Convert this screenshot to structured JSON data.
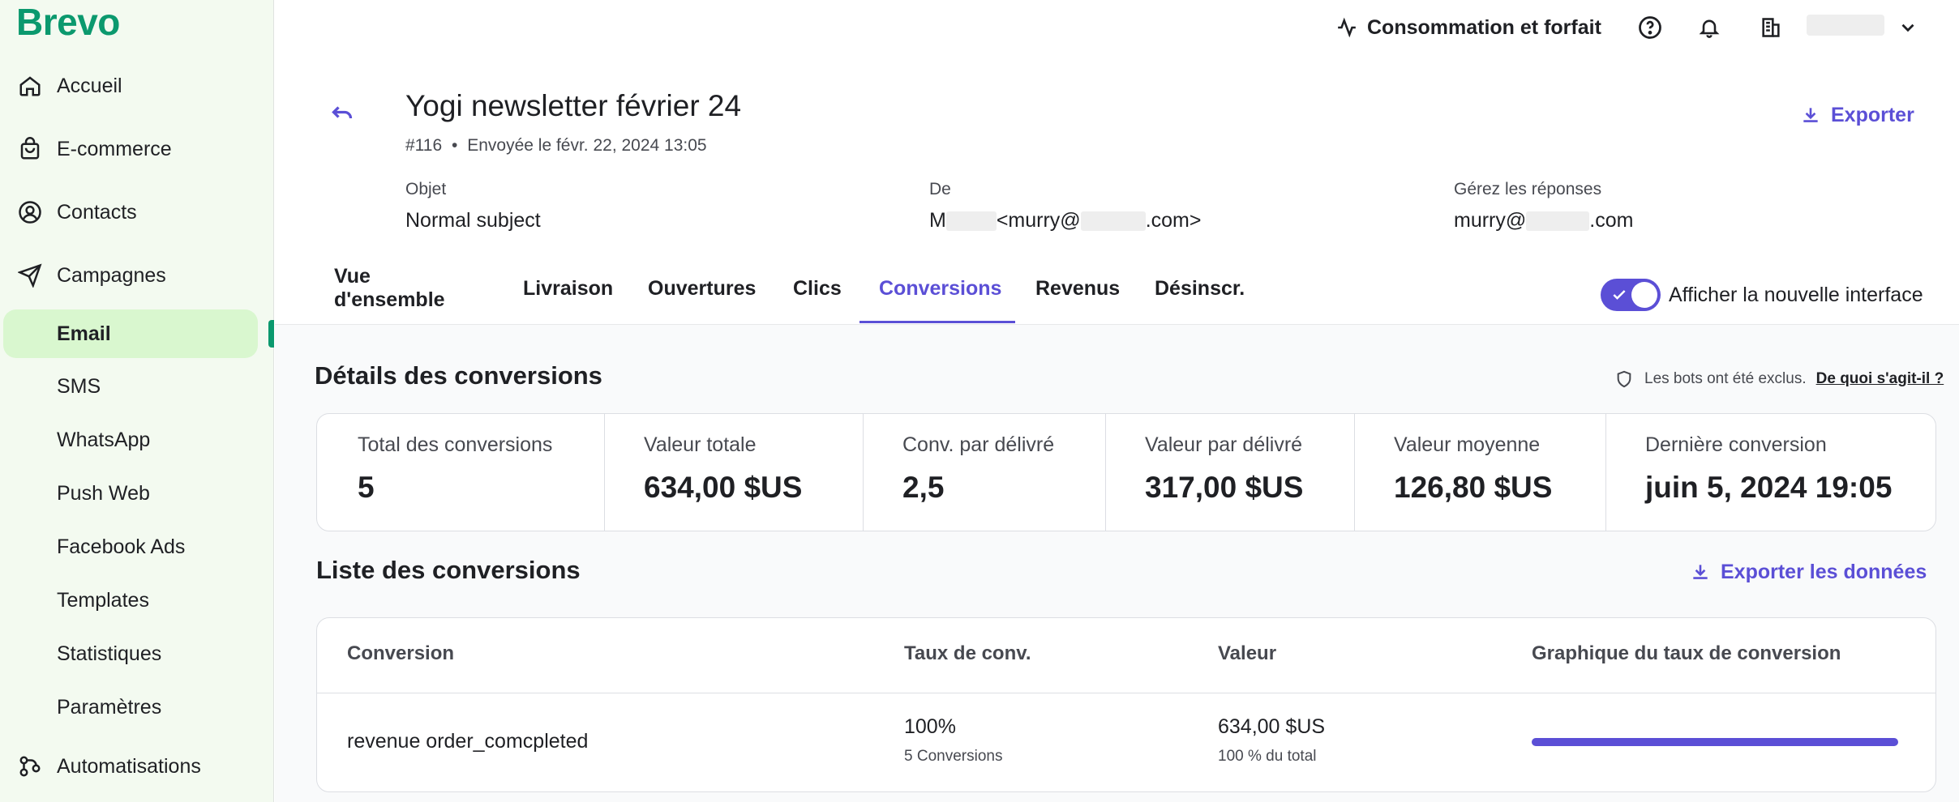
{
  "brand": {
    "name": "Brevo",
    "color": "#0b996e"
  },
  "sidebar": {
    "items": [
      {
        "label": "Accueil",
        "icon": "home-icon"
      },
      {
        "label": "E-commerce",
        "icon": "shopping-bag-icon"
      },
      {
        "label": "Contacts",
        "icon": "contacts-icon"
      },
      {
        "label": "Campagnes",
        "icon": "paper-plane-icon"
      }
    ],
    "sub_items": [
      "Email",
      "SMS",
      "WhatsApp",
      "Push Web",
      "Facebook Ads",
      "Templates",
      "Statistiques",
      "Paramètres"
    ],
    "active_sub": "Email",
    "bottom_item": {
      "label": "Automatisations",
      "icon": "automation-icon"
    }
  },
  "topbar": {
    "usage_label": "Consommation et forfait",
    "icons": [
      "pulse-icon",
      "help-icon",
      "bell-icon",
      "building-icon",
      "chevron-down-icon"
    ]
  },
  "campaign": {
    "title": "Yogi newsletter février 24",
    "number": "#116",
    "separator": "•",
    "sent_label": "Envoyée le févr. 22, 2024 13:05",
    "export_label": "Exporter",
    "fields": {
      "object_label": "Objet",
      "object_value": "Normal subject",
      "from_label": "De",
      "from_value_prefix": "M",
      "from_value_mid": "<murry@",
      "from_value_suffix": ".com>",
      "replies_label": "Gérez les réponses",
      "replies_value_prefix": "murry@",
      "replies_value_suffix": ".com"
    }
  },
  "tabs": {
    "items": [
      "Vue d'ensemble",
      "Livraison",
      "Ouvertures",
      "Clics",
      "Conversions",
      "Revenus",
      "Désinscr."
    ],
    "active": "Conversions",
    "toggle_label": "Afficher la nouvelle interface",
    "toggle_on": true
  },
  "conversions": {
    "title": "Détails des conversions",
    "bots_note": "Les bots ont été exclus.",
    "bots_link": "De quoi s'agit-il ?",
    "stats": [
      {
        "label": "Total des conversions",
        "value": "5"
      },
      {
        "label": "Valeur totale",
        "value": "634,00 $US"
      },
      {
        "label": "Conv. par délivré",
        "value": "2,5"
      },
      {
        "label": "Valeur par délivré",
        "value": "317,00 $US"
      },
      {
        "label": "Valeur moyenne",
        "value": "126,80 $US"
      },
      {
        "label": "Dernière conversion",
        "value": "juin 5, 2024 19:05"
      }
    ]
  },
  "list": {
    "title": "Liste des conversions",
    "export_label": "Exporter les données",
    "columns": [
      "Conversion",
      "Taux de conv.",
      "Valeur",
      "Graphique du taux de conversion"
    ],
    "rows": [
      {
        "name": "revenue order_comcpleted",
        "rate": "100%",
        "rate_sub": "5 Conversions",
        "value": "634,00 $US",
        "value_sub": "100 % du total",
        "rate_fraction": 1.0
      }
    ]
  },
  "colors": {
    "accent": "#5b4fd6",
    "sidebar_bg": "#f3faf0",
    "active_bg": "#d9f7cf"
  }
}
